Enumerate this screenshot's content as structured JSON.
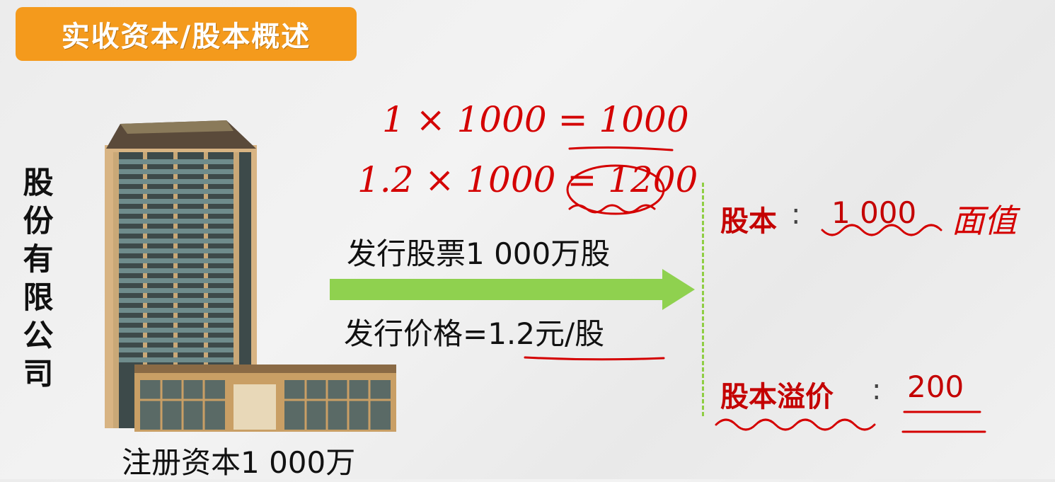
{
  "title": "实收资本/股本概述",
  "company_name_chars": [
    "股",
    "份",
    "有",
    "限",
    "公",
    "司"
  ],
  "building_caption": "注册资本1 000万",
  "issue_shares": "发行股票1 000万股",
  "issue_price": "发行价格=1.2元/股",
  "handwritten": {
    "line1": "1 × 1000 = 1000",
    "line2": "1.2 × 1000 = 1200",
    "face_value_note": "面值"
  },
  "results": {
    "share_capital_label": "股本",
    "share_capital_colon": ":",
    "share_capital_value": "1 000",
    "premium_label": "股本溢价",
    "premium_colon": ":",
    "premium_value": "200"
  },
  "colors": {
    "title_bg": "#f49a1c",
    "arrow": "#8fd14f",
    "red_label": "#c40000",
    "handwriting": "#d40000"
  }
}
